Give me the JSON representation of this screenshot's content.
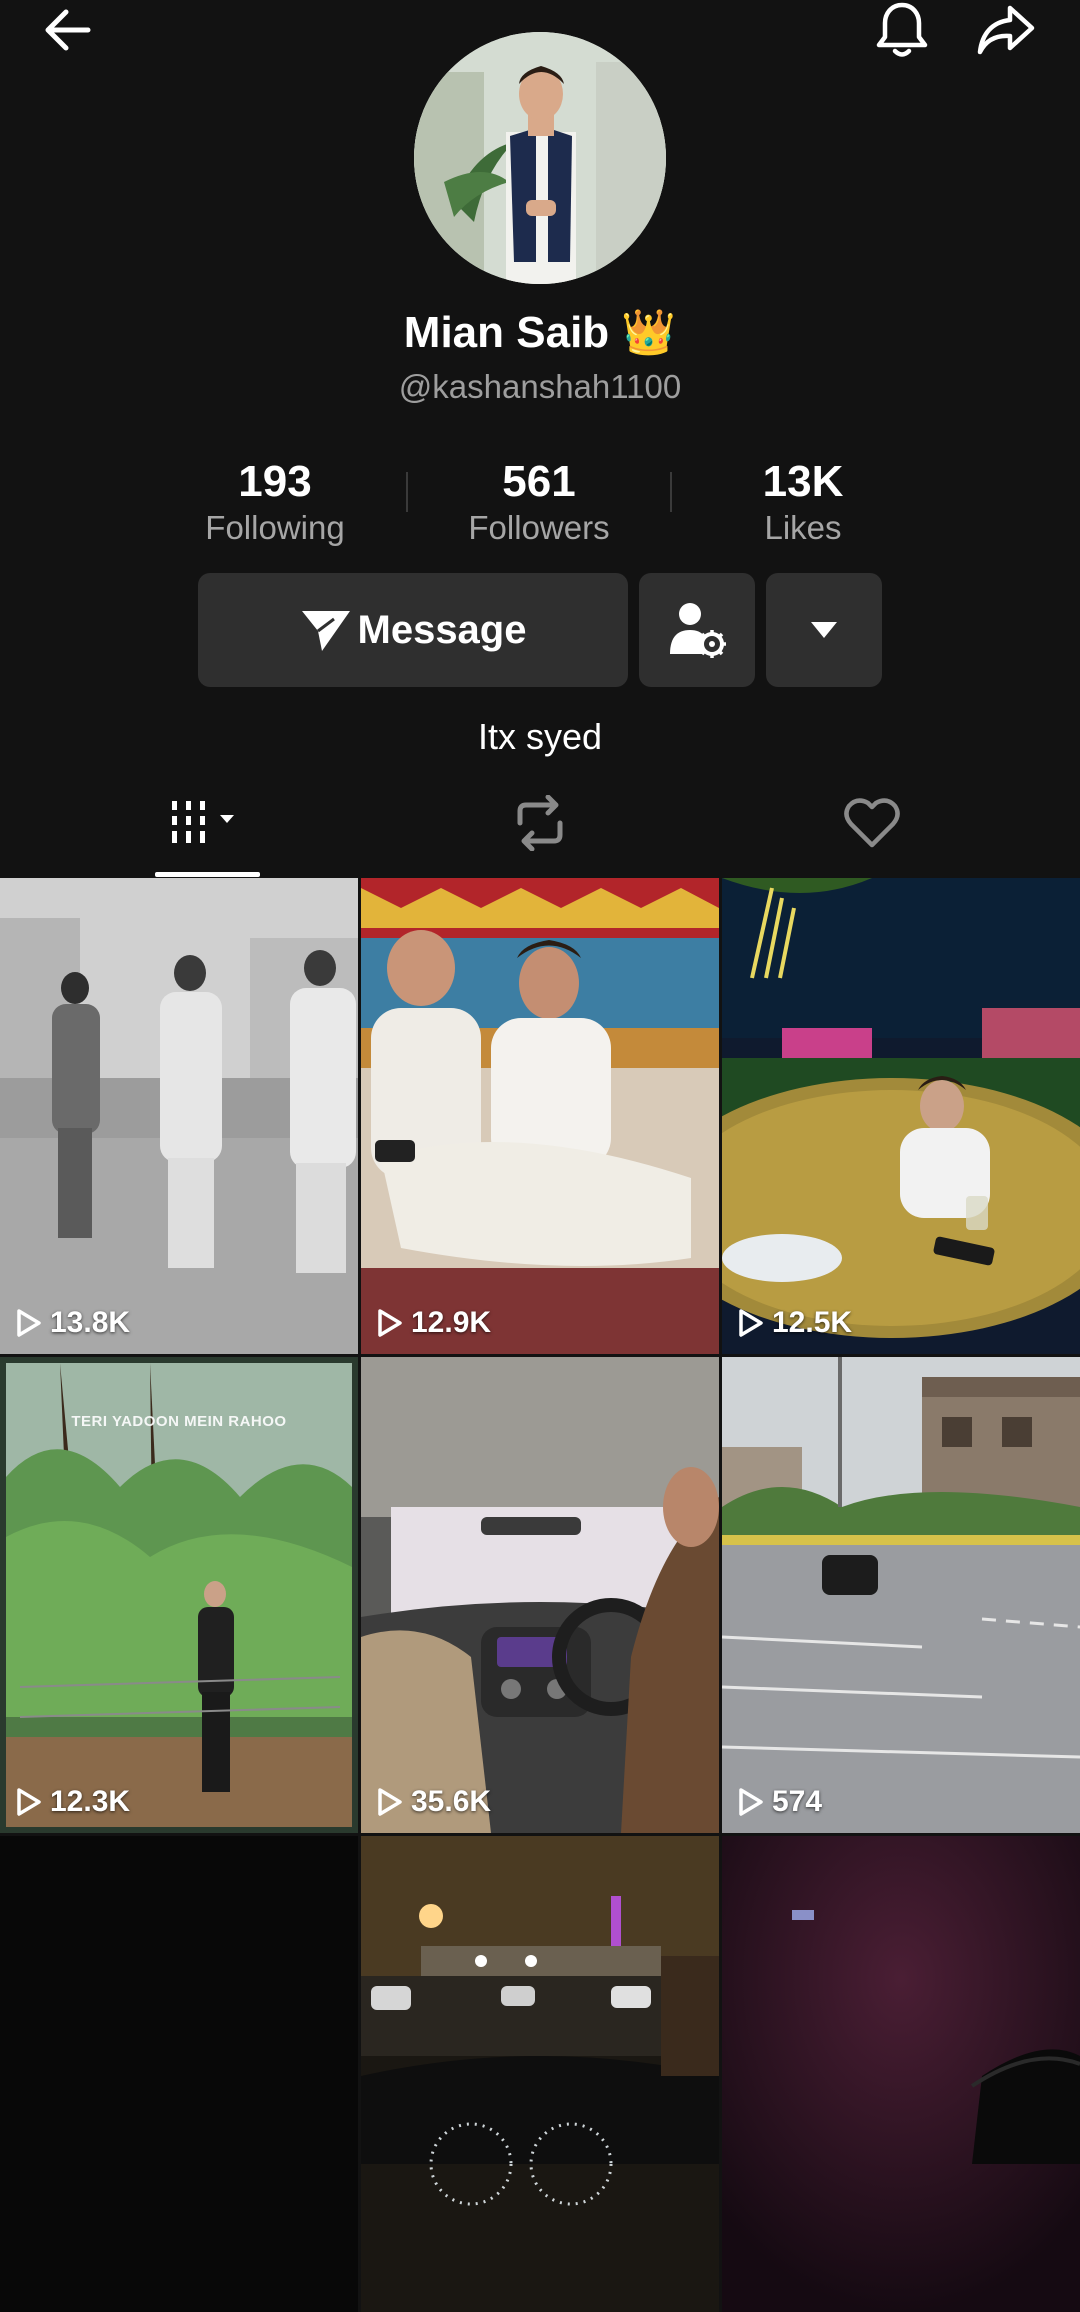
{
  "profile": {
    "display_name": "Mian Saib 👑",
    "username": "@kashanshah1100",
    "bio": "Itx syed"
  },
  "stats": {
    "following": {
      "value": "193",
      "label": "Following"
    },
    "followers": {
      "value": "561",
      "label": "Followers"
    },
    "likes": {
      "value": "13K",
      "label": "Likes"
    }
  },
  "actions": {
    "message_label": "Message"
  },
  "icons": {
    "back": "arrow-left-icon",
    "notifications": "bell-icon",
    "share": "share-arrow-icon",
    "message": "send-icon",
    "friend_settings": "person-gear-icon",
    "more": "caret-down-icon",
    "videos_tab": "grid-columns-icon",
    "reposts_tab": "repost-icon",
    "liked_tab": "heart-icon",
    "views": "play-icon"
  },
  "videos": [
    {
      "views": "13.8K"
    },
    {
      "views": "12.9K"
    },
    {
      "views": "12.5K"
    },
    {
      "views": "12.3K",
      "overlay_text": "TERI YADOON MEIN RAHOO"
    },
    {
      "views": "35.6K"
    },
    {
      "views": "574"
    },
    {},
    {},
    {}
  ],
  "colors": {
    "background": "#121212",
    "button": "#2f2f2f",
    "secondary_text": "#a6a6a6"
  }
}
